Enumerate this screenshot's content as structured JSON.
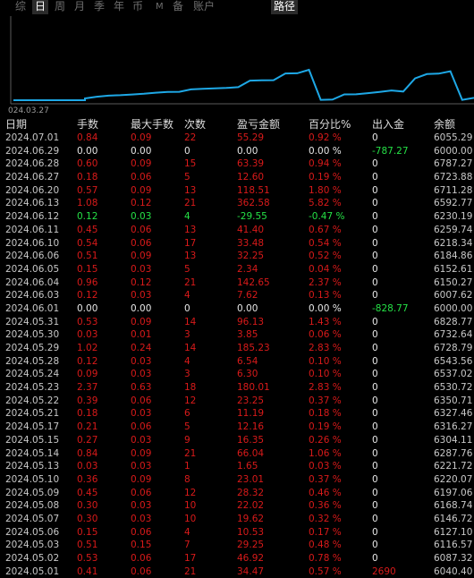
{
  "tabs": [
    {
      "label": "综",
      "active": false
    },
    {
      "label": "日",
      "active": true
    },
    {
      "label": "周",
      "active": false
    },
    {
      "label": "月",
      "active": false
    },
    {
      "label": "季",
      "active": false
    },
    {
      "label": "年",
      "active": false
    },
    {
      "label": "币",
      "active": false
    },
    {
      "label": "M",
      "active": false
    },
    {
      "label": "备",
      "active": false
    },
    {
      "label": "账户",
      "active": false
    },
    {
      "label": "路径",
      "active": true
    }
  ],
  "chart": {
    "start_label": "024.03.27",
    "line_color": "#1ea8e6"
  },
  "colors": {
    "loss": "#d81a1a",
    "gain": "#25e046",
    "neutral": "#e6e6e6"
  },
  "table": {
    "headers": [
      "日期",
      "手数",
      "最大手数",
      "次数",
      "盈亏金额",
      "百分比%",
      "出入金",
      "余额"
    ],
    "rows": [
      {
        "date": "2024.07.01",
        "lots": "0.84",
        "max_lots": "0.09",
        "count": "22",
        "pnl": "55.29",
        "pct": "0.92 %",
        "flow": "0",
        "balance": "6055.29",
        "tone": "red",
        "flow_tone": "white"
      },
      {
        "date": "2024.06.29",
        "lots": "0.00",
        "max_lots": "0.00",
        "count": "0",
        "pnl": "0.00",
        "pct": "0.00 %",
        "flow": "-787.27",
        "balance": "6000.00",
        "tone": "white",
        "flow_tone": "green"
      },
      {
        "date": "2024.06.28",
        "lots": "0.60",
        "max_lots": "0.09",
        "count": "15",
        "pnl": "63.39",
        "pct": "0.94 %",
        "flow": "0",
        "balance": "6787.27",
        "tone": "red",
        "flow_tone": "white"
      },
      {
        "date": "2024.06.27",
        "lots": "0.18",
        "max_lots": "0.06",
        "count": "5",
        "pnl": "12.60",
        "pct": "0.19 %",
        "flow": "0",
        "balance": "6723.88",
        "tone": "red",
        "flow_tone": "white"
      },
      {
        "date": "2024.06.20",
        "lots": "0.57",
        "max_lots": "0.09",
        "count": "13",
        "pnl": "118.51",
        "pct": "1.80 %",
        "flow": "0",
        "balance": "6711.28",
        "tone": "red",
        "flow_tone": "white"
      },
      {
        "date": "2024.06.13",
        "lots": "1.08",
        "max_lots": "0.12",
        "count": "21",
        "pnl": "362.58",
        "pct": "5.82 %",
        "flow": "0",
        "balance": "6592.77",
        "tone": "red",
        "flow_tone": "white"
      },
      {
        "date": "2024.06.12",
        "lots": "0.12",
        "max_lots": "0.03",
        "count": "4",
        "pnl": "-29.55",
        "pct": "-0.47 %",
        "flow": "0",
        "balance": "6230.19",
        "tone": "green",
        "flow_tone": "white"
      },
      {
        "date": "2024.06.11",
        "lots": "0.45",
        "max_lots": "0.06",
        "count": "13",
        "pnl": "41.40",
        "pct": "0.67 %",
        "flow": "0",
        "balance": "6259.74",
        "tone": "red",
        "flow_tone": "white"
      },
      {
        "date": "2024.06.10",
        "lots": "0.54",
        "max_lots": "0.06",
        "count": "17",
        "pnl": "33.48",
        "pct": "0.54 %",
        "flow": "0",
        "balance": "6218.34",
        "tone": "red",
        "flow_tone": "white"
      },
      {
        "date": "2024.06.06",
        "lots": "0.51",
        "max_lots": "0.09",
        "count": "13",
        "pnl": "32.25",
        "pct": "0.52 %",
        "flow": "0",
        "balance": "6184.86",
        "tone": "red",
        "flow_tone": "white"
      },
      {
        "date": "2024.06.05",
        "lots": "0.15",
        "max_lots": "0.03",
        "count": "5",
        "pnl": "2.34",
        "pct": "0.04 %",
        "flow": "0",
        "balance": "6152.61",
        "tone": "red",
        "flow_tone": "white"
      },
      {
        "date": "2024.06.04",
        "lots": "0.96",
        "max_lots": "0.12",
        "count": "21",
        "pnl": "142.65",
        "pct": "2.37 %",
        "flow": "0",
        "balance": "6150.27",
        "tone": "red",
        "flow_tone": "white"
      },
      {
        "date": "2024.06.03",
        "lots": "0.12",
        "max_lots": "0.03",
        "count": "4",
        "pnl": "7.62",
        "pct": "0.13 %",
        "flow": "0",
        "balance": "6007.62",
        "tone": "red",
        "flow_tone": "white"
      },
      {
        "date": "2024.06.01",
        "lots": "0.00",
        "max_lots": "0.00",
        "count": "0",
        "pnl": "0.00",
        "pct": "0.00 %",
        "flow": "-828.77",
        "balance": "6000.00",
        "tone": "white",
        "flow_tone": "green"
      },
      {
        "date": "2024.05.31",
        "lots": "0.53",
        "max_lots": "0.09",
        "count": "14",
        "pnl": "96.13",
        "pct": "1.43 %",
        "flow": "0",
        "balance": "6828.77",
        "tone": "red",
        "flow_tone": "white"
      },
      {
        "date": "2024.05.30",
        "lots": "0.03",
        "max_lots": "0.01",
        "count": "3",
        "pnl": "3.85",
        "pct": "0.06 %",
        "flow": "0",
        "balance": "6732.64",
        "tone": "red",
        "flow_tone": "white"
      },
      {
        "date": "2024.05.29",
        "lots": "1.02",
        "max_lots": "0.24",
        "count": "14",
        "pnl": "185.23",
        "pct": "2.83 %",
        "flow": "0",
        "balance": "6728.79",
        "tone": "red",
        "flow_tone": "white"
      },
      {
        "date": "2024.05.28",
        "lots": "0.12",
        "max_lots": "0.03",
        "count": "4",
        "pnl": "6.54",
        "pct": "0.10 %",
        "flow": "0",
        "balance": "6543.56",
        "tone": "red",
        "flow_tone": "white"
      },
      {
        "date": "2024.05.24",
        "lots": "0.09",
        "max_lots": "0.03",
        "count": "3",
        "pnl": "6.30",
        "pct": "0.10 %",
        "flow": "0",
        "balance": "6537.02",
        "tone": "red",
        "flow_tone": "white"
      },
      {
        "date": "2024.05.23",
        "lots": "2.37",
        "max_lots": "0.63",
        "count": "18",
        "pnl": "180.01",
        "pct": "2.83 %",
        "flow": "0",
        "balance": "6530.72",
        "tone": "red",
        "flow_tone": "white"
      },
      {
        "date": "2024.05.22",
        "lots": "0.39",
        "max_lots": "0.06",
        "count": "12",
        "pnl": "23.25",
        "pct": "0.37 %",
        "flow": "0",
        "balance": "6350.71",
        "tone": "red",
        "flow_tone": "white"
      },
      {
        "date": "2024.05.21",
        "lots": "0.18",
        "max_lots": "0.03",
        "count": "6",
        "pnl": "11.19",
        "pct": "0.18 %",
        "flow": "0",
        "balance": "6327.46",
        "tone": "red",
        "flow_tone": "white"
      },
      {
        "date": "2024.05.17",
        "lots": "0.21",
        "max_lots": "0.06",
        "count": "5",
        "pnl": "12.16",
        "pct": "0.19 %",
        "flow": "0",
        "balance": "6316.27",
        "tone": "red",
        "flow_tone": "white"
      },
      {
        "date": "2024.05.15",
        "lots": "0.27",
        "max_lots": "0.03",
        "count": "9",
        "pnl": "16.35",
        "pct": "0.26 %",
        "flow": "0",
        "balance": "6304.11",
        "tone": "red",
        "flow_tone": "white"
      },
      {
        "date": "2024.05.14",
        "lots": "0.84",
        "max_lots": "0.09",
        "count": "21",
        "pnl": "66.04",
        "pct": "1.06 %",
        "flow": "0",
        "balance": "6287.76",
        "tone": "red",
        "flow_tone": "white"
      },
      {
        "date": "2024.05.13",
        "lots": "0.03",
        "max_lots": "0.03",
        "count": "1",
        "pnl": "1.65",
        "pct": "0.03 %",
        "flow": "0",
        "balance": "6221.72",
        "tone": "red",
        "flow_tone": "white"
      },
      {
        "date": "2024.05.10",
        "lots": "0.36",
        "max_lots": "0.09",
        "count": "8",
        "pnl": "23.01",
        "pct": "0.37 %",
        "flow": "0",
        "balance": "6220.07",
        "tone": "red",
        "flow_tone": "white"
      },
      {
        "date": "2024.05.09",
        "lots": "0.45",
        "max_lots": "0.06",
        "count": "12",
        "pnl": "28.32",
        "pct": "0.46 %",
        "flow": "0",
        "balance": "6197.06",
        "tone": "red",
        "flow_tone": "white"
      },
      {
        "date": "2024.05.08",
        "lots": "0.30",
        "max_lots": "0.03",
        "count": "10",
        "pnl": "22.02",
        "pct": "0.36 %",
        "flow": "0",
        "balance": "6168.74",
        "tone": "red",
        "flow_tone": "white"
      },
      {
        "date": "2024.05.07",
        "lots": "0.30",
        "max_lots": "0.03",
        "count": "10",
        "pnl": "19.62",
        "pct": "0.32 %",
        "flow": "0",
        "balance": "6146.72",
        "tone": "red",
        "flow_tone": "white"
      },
      {
        "date": "2024.05.06",
        "lots": "0.15",
        "max_lots": "0.06",
        "count": "4",
        "pnl": "10.53",
        "pct": "0.17 %",
        "flow": "0",
        "balance": "6127.10",
        "tone": "red",
        "flow_tone": "white"
      },
      {
        "date": "2024.05.03",
        "lots": "0.51",
        "max_lots": "0.15",
        "count": "7",
        "pnl": "29.25",
        "pct": "0.48 %",
        "flow": "0",
        "balance": "6116.57",
        "tone": "red",
        "flow_tone": "white"
      },
      {
        "date": "2024.05.02",
        "lots": "0.53",
        "max_lots": "0.06",
        "count": "17",
        "pnl": "46.92",
        "pct": "0.78 %",
        "flow": "0",
        "balance": "6087.32",
        "tone": "red",
        "flow_tone": "white"
      },
      {
        "date": "2024.05.01",
        "lots": "0.41",
        "max_lots": "0.06",
        "count": "21",
        "pnl": "34.47",
        "pct": "0.57 %",
        "flow": "2690",
        "balance": "6040.40",
        "tone": "red",
        "flow_tone": "red"
      }
    ]
  }
}
